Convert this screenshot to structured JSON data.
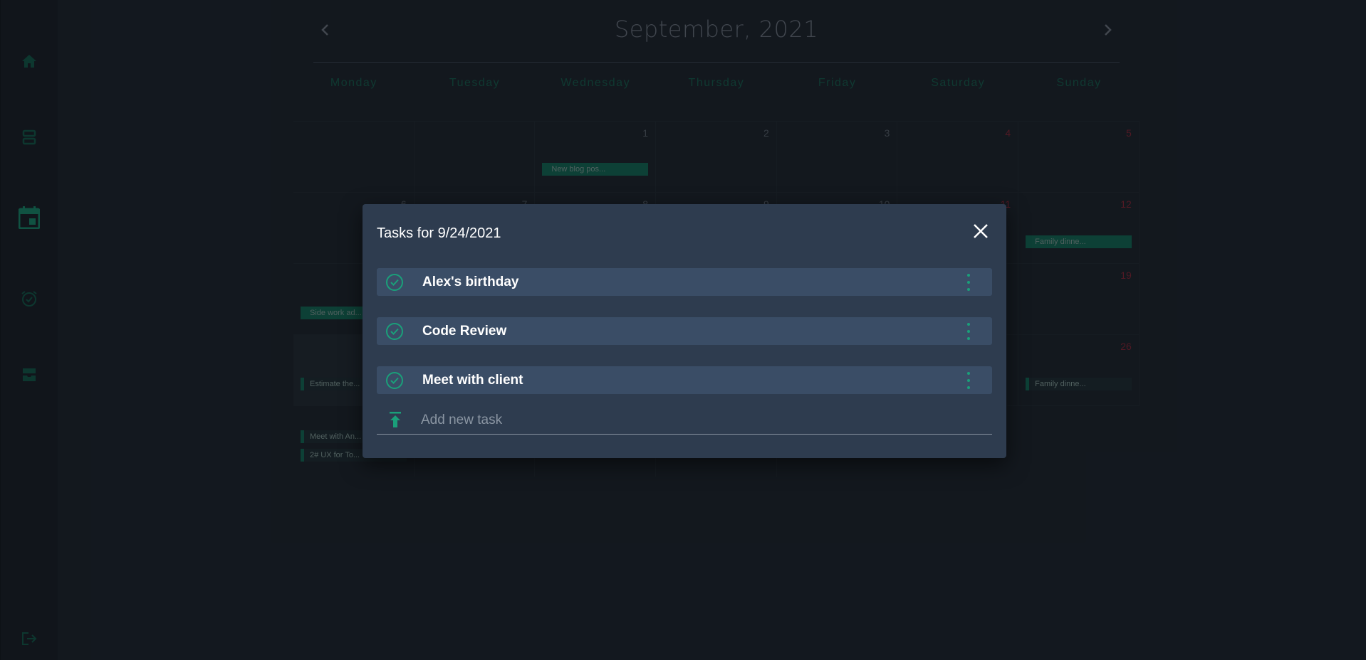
{
  "sidebar": {
    "items": [
      {
        "icon": "home-icon"
      },
      {
        "icon": "layers-icon"
      },
      {
        "icon": "calendar-icon",
        "active": true
      },
      {
        "icon": "alarm-icon"
      },
      {
        "icon": "inbox-icon"
      }
    ],
    "logout_icon": "logout-icon"
  },
  "calendar": {
    "month_title": "September, 2021",
    "weekdays": [
      "Monday",
      "Tuesday",
      "Wednesday",
      "Thursday",
      "Friday",
      "Saturday",
      "Sunday"
    ],
    "days": {
      "d1": "1",
      "d2": "2",
      "d3": "3",
      "d4": "4",
      "d5": "5",
      "d6": "6",
      "d7": "7",
      "d8": "8",
      "d9": "9",
      "d10": "10",
      "d11": "11",
      "d12": "12",
      "d19": "19",
      "d26": "26"
    },
    "events": {
      "e1": "New blog pos...",
      "e2": "Family dinne...",
      "e3": "Side work ad...",
      "e4": "Estimate the...",
      "e5": "Family dinne...",
      "e6": "Meet with An...",
      "e7": "2# UX for To..."
    }
  },
  "modal": {
    "title": "Tasks for 9/24/2021",
    "tasks": [
      {
        "label": "Alex's birthday"
      },
      {
        "label": "Code Review"
      },
      {
        "label": "Meet with client"
      }
    ],
    "add_placeholder": "Add new task"
  },
  "colors": {
    "accent": "#1aa07a",
    "background": "#1a2129",
    "modal_bg": "#2e3c4f",
    "task_bg": "#3a4d66",
    "weekend": "#8a2434"
  }
}
